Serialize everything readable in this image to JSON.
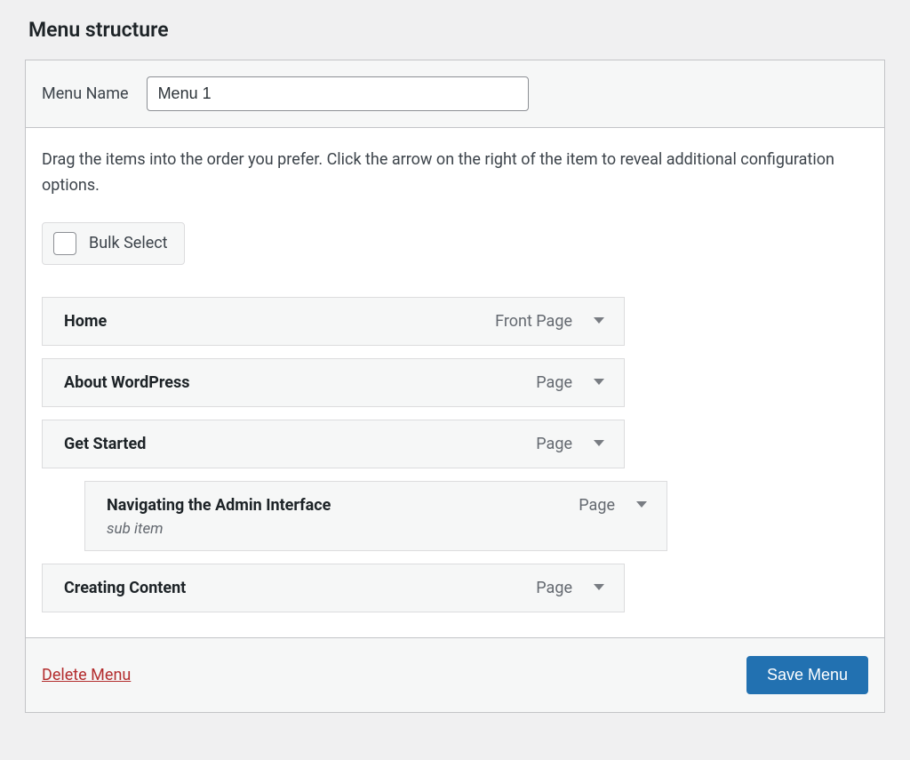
{
  "page_title": "Menu structure",
  "menu_name": {
    "label": "Menu Name",
    "value": "Menu 1"
  },
  "instructions": "Drag the items into the order you prefer. Click the arrow on the right of the item to reveal additional configuration options.",
  "bulk_select": {
    "label": "Bulk Select"
  },
  "menu_items": [
    {
      "title": "Home",
      "type": "Front Page",
      "indent": 0
    },
    {
      "title": "About WordPress",
      "type": "Page",
      "indent": 0
    },
    {
      "title": "Get Started",
      "type": "Page",
      "indent": 0
    },
    {
      "title": "Navigating the Admin Interface",
      "type": "Page",
      "indent": 1,
      "sub_label": "sub item"
    },
    {
      "title": "Creating Content",
      "type": "Page",
      "indent": 0
    }
  ],
  "footer": {
    "delete_label": "Delete Menu",
    "save_label": "Save Menu"
  }
}
